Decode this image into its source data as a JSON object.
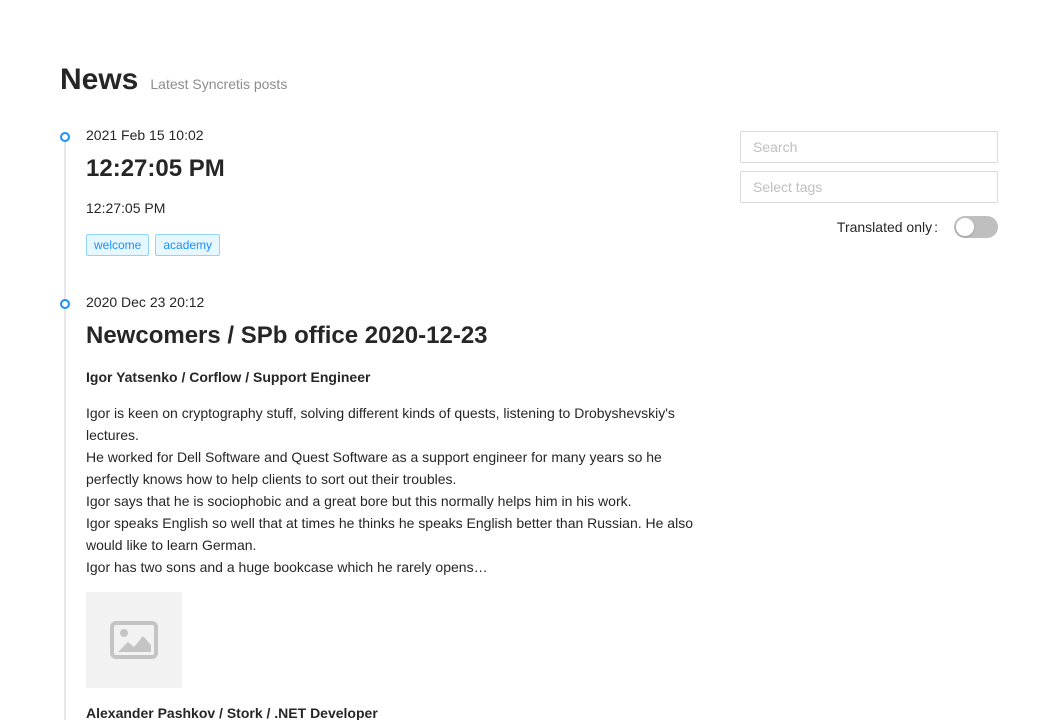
{
  "header": {
    "title": "News",
    "subtitle": "Latest Syncretis posts"
  },
  "sidebar": {
    "search_placeholder": "Search",
    "tags_placeholder": "Select tags",
    "translated_label": "Translated only",
    "translated_colon": ":",
    "translated_on": false
  },
  "posts": [
    {
      "date": "2021 Feb 15 10:02",
      "title": "12:27:05 PM",
      "body": "12:27:05 PM",
      "tags": [
        "welcome",
        "academy"
      ]
    },
    {
      "date": "2020 Dec 23 20:12",
      "title": "Newcomers / SPb office 2020-12-23",
      "person1": "Igor Yatsenko / Corflow / Support Engineer",
      "paragraphs": [
        "Igor is keen on cryptography stuff, solving different kinds of quests, listening to Drobyshevskiy's lectures.",
        "He worked for Dell Software and Quest Software as a support engineer for many years so he perfectly knows how to help clients to sort out their troubles.",
        "Igor says that he is sociophobic and a great bore but this normally helps him in his work.",
        "Igor speaks English so well that at times he thinks he speaks English better than Russian. He also would like to learn German.",
        "Igor has two sons and a huge bookcase which he rarely opens…"
      ],
      "image_icon": "image-placeholder-icon",
      "person2": "Alexander Pashkov / Stork / .NET Developer"
    }
  ],
  "colors": {
    "accent": "#1890ff",
    "tag_bg": "#e6f7ff",
    "tag_border": "#91d5ff",
    "switch_off": "#bfbfbf"
  }
}
